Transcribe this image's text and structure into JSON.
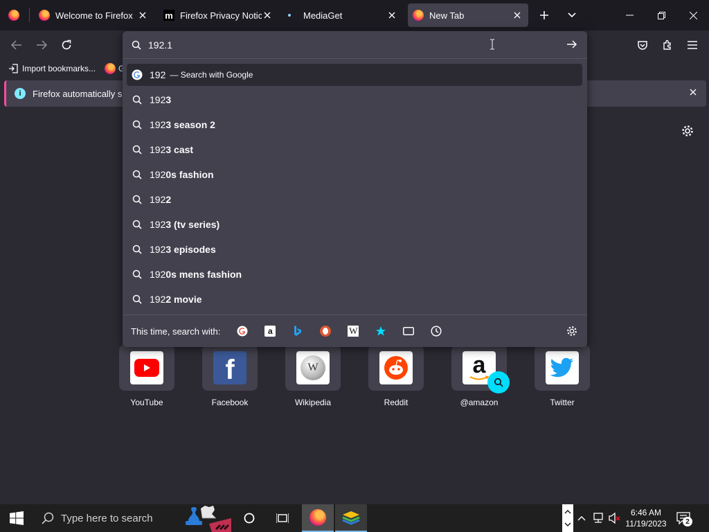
{
  "tabs": [
    {
      "title": "Welcome to Firefox"
    },
    {
      "title": "Firefox Privacy Notice —"
    },
    {
      "title": "MediaGet"
    },
    {
      "title": "New Tab"
    }
  ],
  "bookmarks": {
    "import_label": "Import bookmarks...",
    "second_label": "G"
  },
  "notice": {
    "text": "Firefox automatically sen"
  },
  "urlbar": {
    "value": "192.1",
    "first_row": {
      "text": "192",
      "action": "— Search with Google"
    },
    "suggestions": [
      {
        "prefix": "192",
        "rest": "3"
      },
      {
        "prefix": "192",
        "rest": "3 season 2"
      },
      {
        "prefix": "192",
        "rest": "3 cast"
      },
      {
        "prefix": "192",
        "rest": "0s fashion"
      },
      {
        "prefix": "192",
        "rest": "2"
      },
      {
        "prefix": "192",
        "rest": "3 (tv series)"
      },
      {
        "prefix": "192",
        "rest": "3 episodes"
      },
      {
        "prefix": "192",
        "rest": "0s mens fashion"
      },
      {
        "prefix": "192",
        "rest": "2 movie"
      }
    ],
    "oneoff_label": "This time, search with:"
  },
  "tiles": [
    {
      "label": "YouTube"
    },
    {
      "label": "Facebook"
    },
    {
      "label": "Wikipedia"
    },
    {
      "label": "Reddit"
    },
    {
      "label": "@amazon"
    },
    {
      "label": "Twitter"
    }
  ],
  "taskbar": {
    "search_placeholder": "Type here to search",
    "time": "6:46 AM",
    "date": "11/19/2023",
    "notif_count": "2"
  },
  "colors": {
    "accent": "#00ddff",
    "notice_border": "#ff4aa2"
  }
}
